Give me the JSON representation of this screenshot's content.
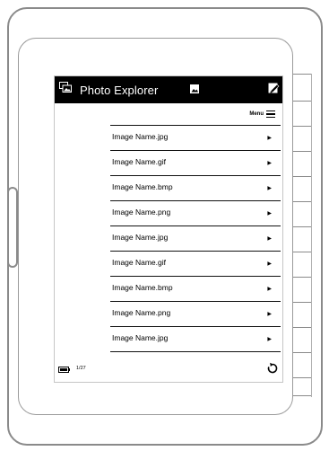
{
  "app": {
    "title": "Photo Explorer"
  },
  "menu": {
    "label": "Menu"
  },
  "files": [
    {
      "name": "Image Name.jpg"
    },
    {
      "name": "Image Name.gif"
    },
    {
      "name": "Image Name.bmp"
    },
    {
      "name": "Image Name.png"
    },
    {
      "name": "Image Name.jpg"
    },
    {
      "name": "Image Name.gif"
    },
    {
      "name": "Image Name.bmp"
    },
    {
      "name": "Image Name.png"
    },
    {
      "name": "Image Name.jpg"
    }
  ],
  "footer": {
    "page_indicator": "1/27"
  },
  "icons": {
    "title": "photo-album-icon",
    "toolbar_1": "image-icon",
    "toolbar_2": "edit-icon",
    "menu": "hamburger-menu-icon",
    "row_arrow": "triangle-right-icon",
    "battery": "battery-icon",
    "refresh": "refresh-icon"
  }
}
